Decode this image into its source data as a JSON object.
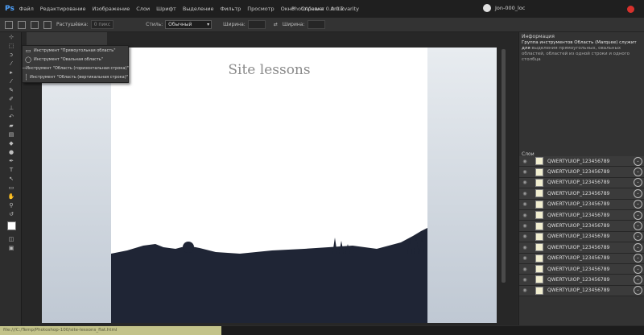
{
  "menubar": {
    "logo": "Ps",
    "items": [
      "Файл",
      "Редактирование",
      "Изображение",
      "Слои",
      "Шрифт",
      "Выделение",
      "Фильтр",
      "Просмотр",
      "Окно",
      "Справка",
      "Antikvarity"
    ],
    "title": "PhotoViewer 0.0.0.2",
    "user": "Jon-000_loc"
  },
  "options": {
    "feather_label": "Растушёвка:",
    "feather_value": "0 пикс",
    "style_label": "Стиль:",
    "style_value": "Обычный",
    "width_label": "Ширина:",
    "height_label": "Ширина:"
  },
  "popup": {
    "items": [
      "Инструмент \"Прямоугольная область\"",
      "Инструмент \"Овальная область\"",
      "Инструмент \"Область (горизонтальная строка)\"",
      "Инструмент \"Область (вертикальная строка)\""
    ]
  },
  "document": {
    "heading": "Site lessons"
  },
  "info": {
    "title": "Информация",
    "text_highlight": "Группа инструментов Область (Marquee) служит для",
    "text": "выделения прямоугольных, овальных областей, областей из одной строки и одного столбца"
  },
  "layers": {
    "title": "Слои",
    "items": [
      "QWERTYUIOP_123456789",
      "QWERTYUIOP_123456789",
      "QWERTYUIOP_123456789",
      "QWERTYUIOP_123456789",
      "QWERTYUIOP_123456789",
      "QWERTYUIOP_123456789",
      "QWERTYUIOP_123456789",
      "QWERTYUIOP_123456789",
      "QWERTYUIOP_123456789",
      "QWERTYUIOP_123456789",
      "QWERTYUIOP_123456789",
      "QWERTYUIOP_123456789",
      "QWERTYUIOP_123456789"
    ]
  },
  "status": {
    "path": "file:///C:/Temp/Photoshop-100/site-lessons_flat.html"
  },
  "colors": {
    "accent": "#4fa3ff",
    "close": "#d8312c",
    "silhouette": "#1f2535",
    "layer_thumb": "#f1eed0"
  }
}
